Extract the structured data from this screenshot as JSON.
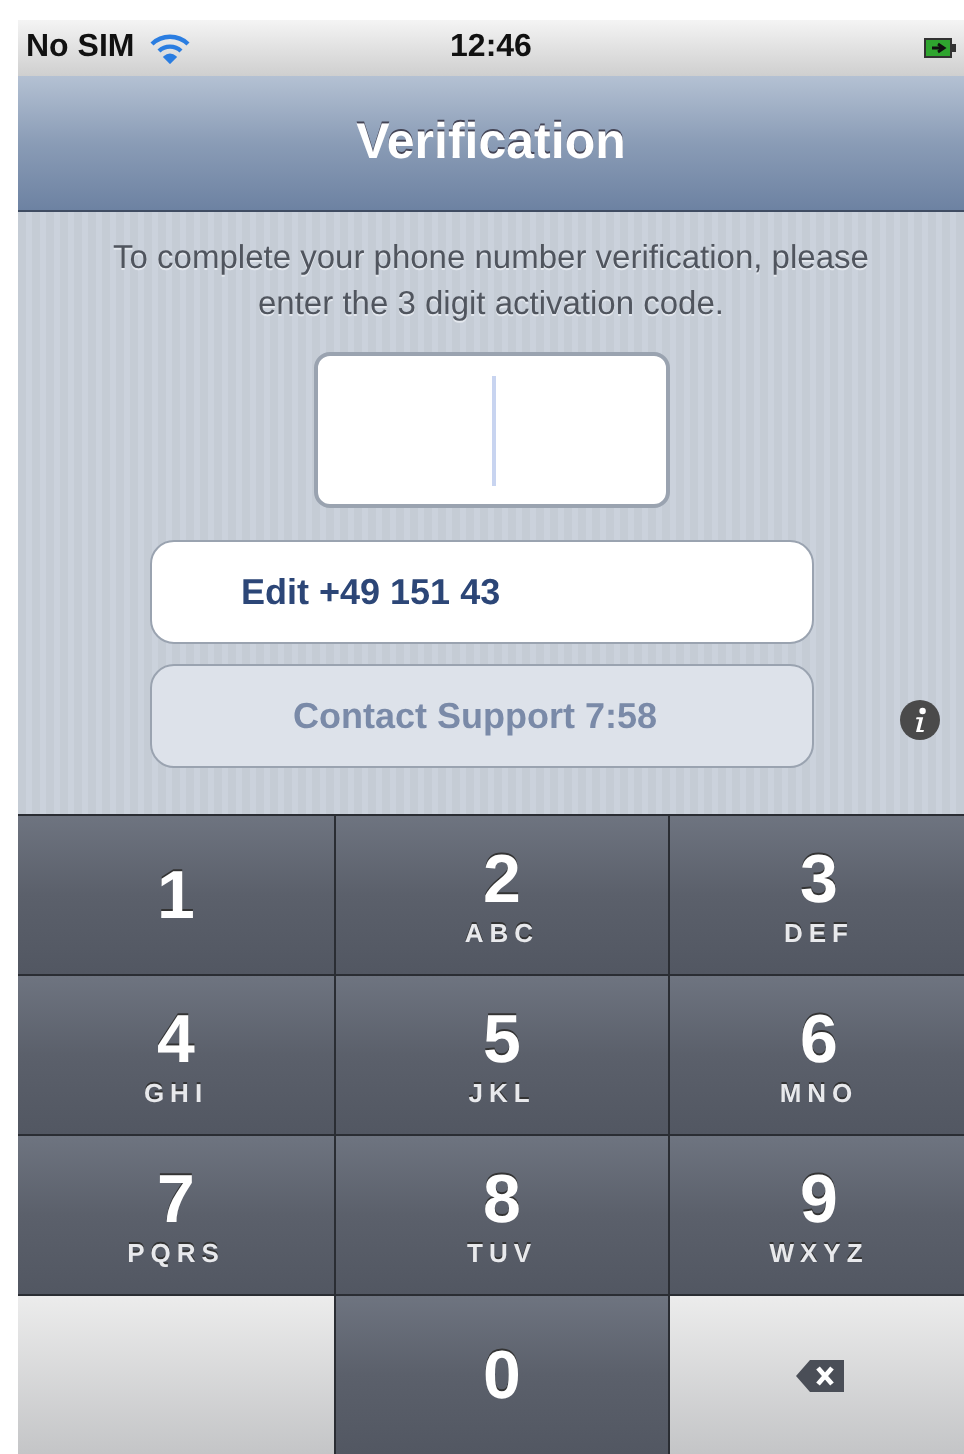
{
  "status_bar": {
    "carrier": "No SIM",
    "time": "12:46"
  },
  "nav_bar": {
    "title": "Verification"
  },
  "instructions": "To complete your phone number verification, please enter the 3 digit activation code.",
  "buttons": [
    {
      "label": "Edit +49 151 43",
      "disabled": false
    },
    {
      "label": "Contact Support 7:58",
      "disabled": true
    }
  ],
  "keypad": [
    {
      "kind": "digit",
      "digit": "1"
    },
    {
      "kind": "digit",
      "digit": "2",
      "letters": "ABC"
    },
    {
      "kind": "digit",
      "digit": "3",
      "letters": "DEF"
    },
    {
      "kind": "digit",
      "digit": "4",
      "letters": "GHI"
    },
    {
      "kind": "digit",
      "digit": "5",
      "letters": "JKL"
    },
    {
      "kind": "digit",
      "digit": "6",
      "letters": "MNO"
    },
    {
      "kind": "digit",
      "digit": "7",
      "letters": "PQRS"
    },
    {
      "kind": "digit",
      "digit": "8",
      "letters": "TUV"
    },
    {
      "kind": "digit",
      "digit": "9",
      "letters": "WXYZ"
    },
    {
      "kind": "blank"
    },
    {
      "kind": "digit",
      "digit": "0"
    },
    {
      "kind": "delete"
    }
  ]
}
